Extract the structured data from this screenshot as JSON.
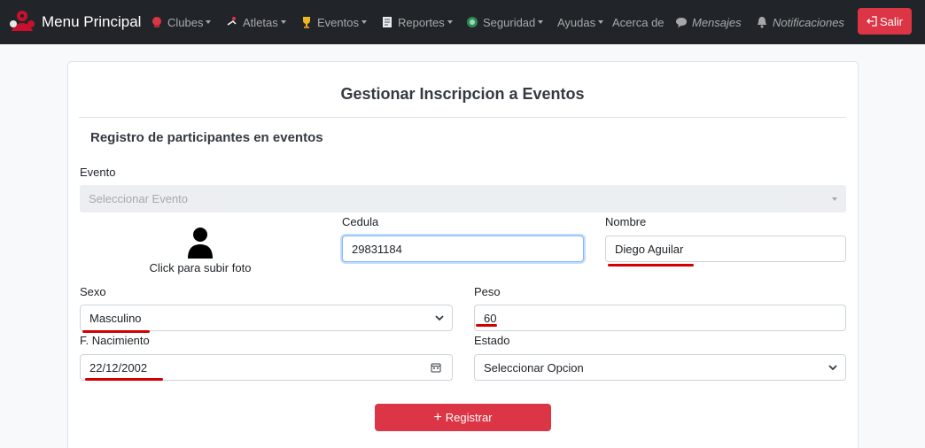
{
  "navbar": {
    "brand": "Menu Principal",
    "items": [
      {
        "label": "Clubes",
        "icon": "boxing-glove-icon",
        "dropdown": true
      },
      {
        "label": "Atletas",
        "icon": "athlete-icon",
        "dropdown": true
      },
      {
        "label": "Eventos",
        "icon": "trophy-icon",
        "dropdown": true
      },
      {
        "label": "Reportes",
        "icon": "report-icon",
        "dropdown": true
      },
      {
        "label": "Seguridad",
        "icon": "shield-icon",
        "dropdown": true
      },
      {
        "label": "Ayudas",
        "dropdown": true
      },
      {
        "label": "Acerca de"
      },
      {
        "label": "Mensajes",
        "icon": "chat-bubble-icon"
      },
      {
        "label": "Notificaciones",
        "icon": "bell-icon"
      }
    ],
    "logout": "Salir"
  },
  "form": {
    "title": "Gestionar Inscripcion a Eventos",
    "subtitle": "Registro de participantes en eventos",
    "evento_label": "Evento",
    "evento_placeholder": "Seleccionar Evento",
    "photo_text": "Click para subir foto",
    "cedula_label": "Cedula",
    "cedula_value": "29831184",
    "nombre_label": "Nombre",
    "nombre_value": "Diego Aguilar",
    "sexo_label": "Sexo",
    "sexo_value": "Masculino",
    "peso_label": "Peso",
    "peso_value": "60",
    "nacimiento_label": "F. Nacimiento",
    "nacimiento_value": "22/12/2002",
    "estado_label": "Estado",
    "estado_value": "Seleccionar Opcion",
    "submit": "Registrar"
  },
  "colors": {
    "navbar_bg": "#212529",
    "danger": "#dc3545",
    "annotation_red": "#d40000"
  }
}
